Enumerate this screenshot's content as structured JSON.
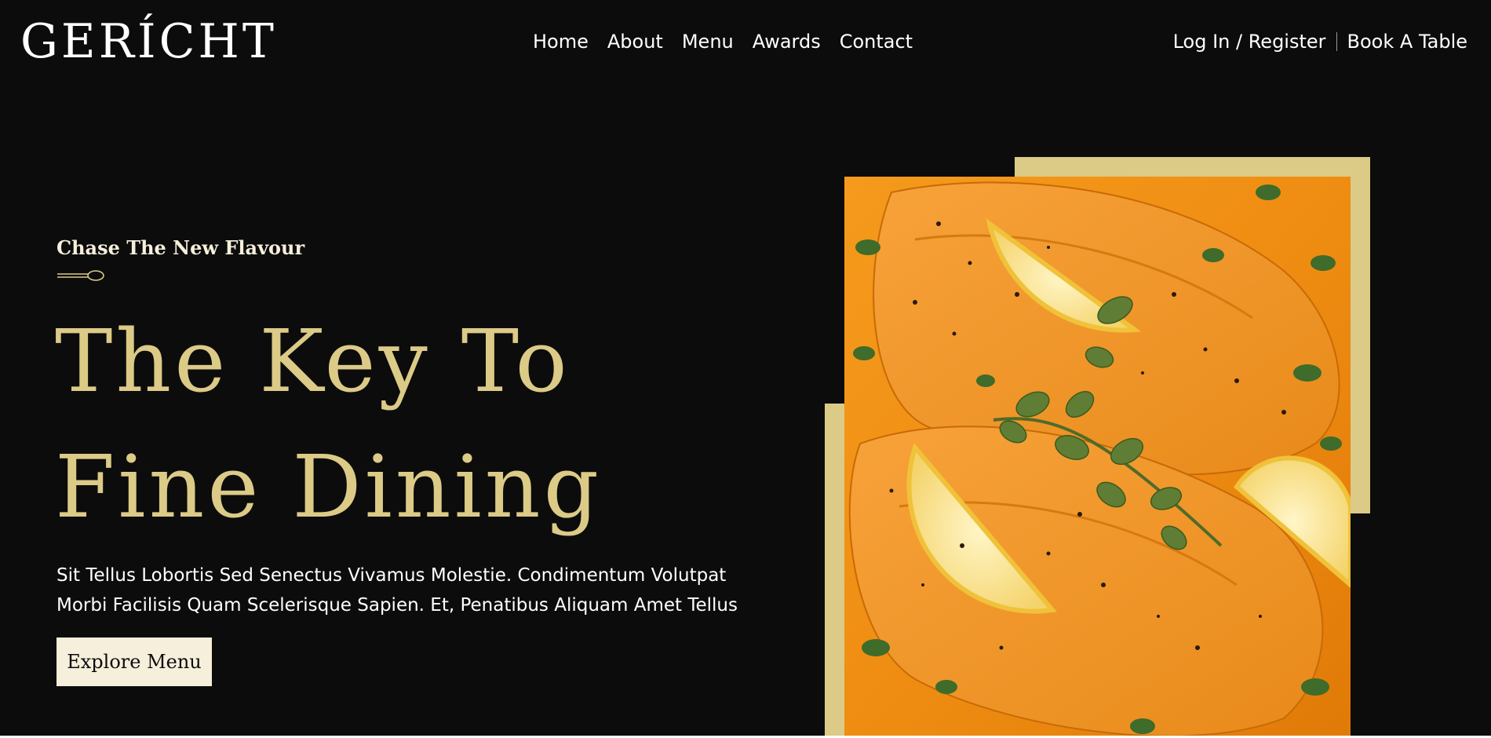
{
  "navbar": {
    "logo": "GERÍCHT",
    "links": [
      "Home",
      "About",
      "Menu",
      "Awards",
      "Contact"
    ],
    "login_label": "Log In / Register",
    "book_label": "Book A Table"
  },
  "hero": {
    "tagline": "Chase The New Flavour",
    "tagline_icon": "spoon-icon",
    "title_lines": [
      "The Key To",
      "Fine Dining"
    ],
    "description": "Sit Tellus Lobortis Sed Senectus Vivamus Molestie. Condimentum Volutpat Morbi Facilisis Quam Scelerisque Sapien. Et, Penatibus Aliquam Amet Tellus",
    "button_label": "Explore Menu",
    "image_subject": "salmon-with-lemon-and-oregano"
  },
  "colors": {
    "background": "#0c0c0c",
    "gold": "#dcca87",
    "cream": "#f5efdb",
    "white": "#ffffff"
  }
}
